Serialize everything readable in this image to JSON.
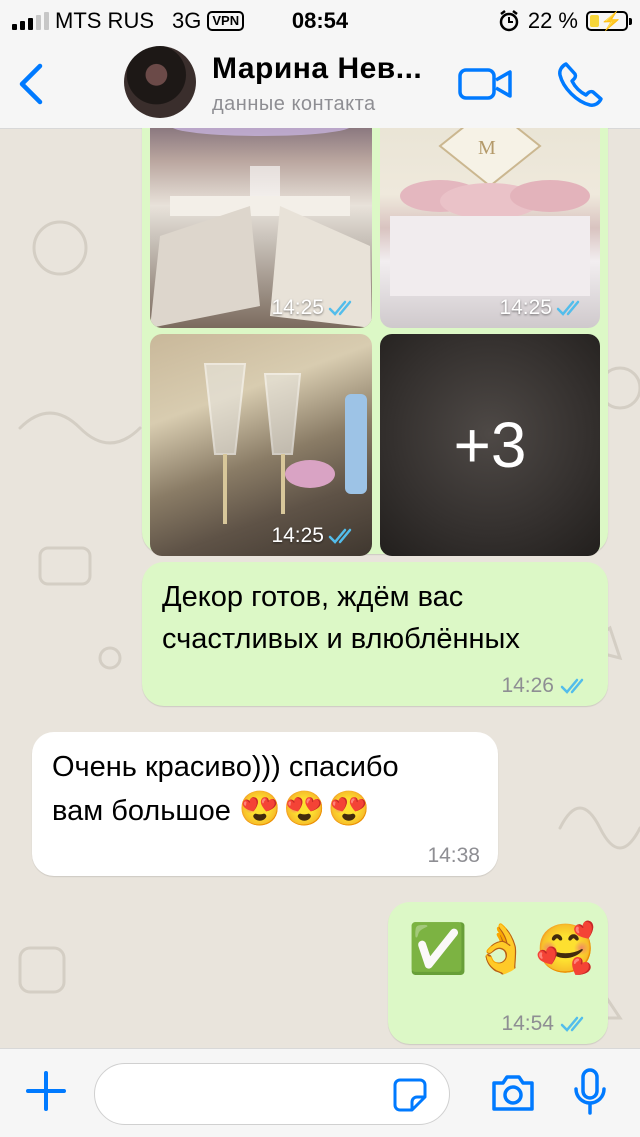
{
  "status_bar": {
    "carrier": "MTS RUS",
    "network": "3G",
    "vpn": "VPN",
    "time": "08:54",
    "battery_percent": "22 %"
  },
  "header": {
    "contact_name": "Марина Нев...",
    "contact_subtitle": "данные контакта"
  },
  "messages": {
    "album": {
      "photos": [
        {
          "time": "14:25"
        },
        {
          "time": "14:25"
        },
        {
          "time": "14:25"
        },
        {
          "more_count": "+3"
        }
      ]
    },
    "m1": {
      "text_line1": "Декор готов, ждём вас",
      "text_line2": "счастливых и влюблённых",
      "time": "14:26"
    },
    "m2": {
      "text_line1": "Очень красиво))) спасибо",
      "text_line2": "вам большое",
      "emojis": "😍😍😍",
      "time": "14:38"
    },
    "m3": {
      "emojis": "✅👌🥰",
      "time": "14:54"
    }
  },
  "input": {
    "value": ""
  },
  "colors": {
    "accent": "#007aff",
    "outgoing": "#dcf8c6",
    "incoming": "#ffffff",
    "ticks": "#34b7f1"
  }
}
